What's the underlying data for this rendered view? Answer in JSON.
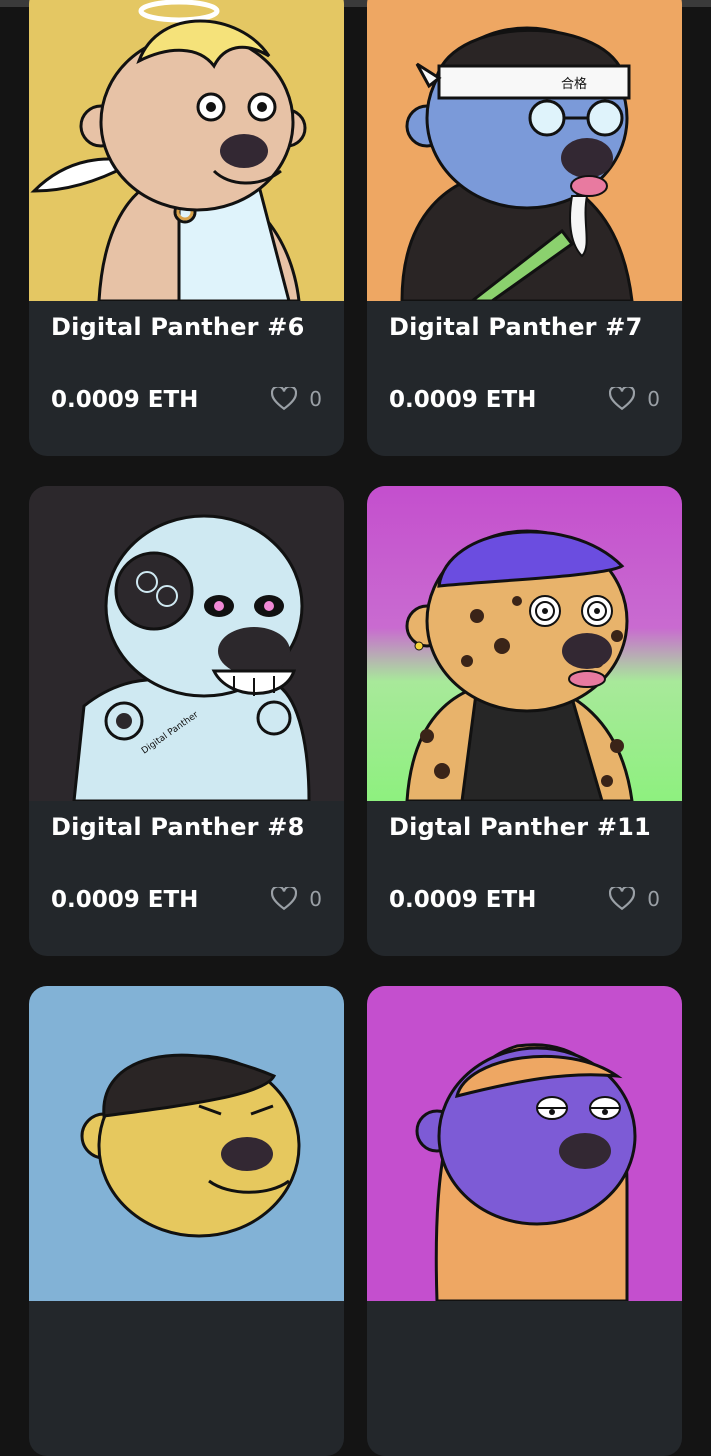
{
  "cards": [
    {
      "name": "Digital Panther #6",
      "price": "0.0009 ETH",
      "likes": "0",
      "art": "angel-bear-art",
      "bg": "#e4c763"
    },
    {
      "name": "Digital Panther #7",
      "price": "0.0009 ETH",
      "likes": "0",
      "art": "student-bear-art",
      "bg": "#eea763"
    },
    {
      "name": "Digital Panther #8",
      "price": "0.0009 ETH",
      "likes": "0",
      "art": "robot-panther-art",
      "bg": "#2c282c"
    },
    {
      "name": "Digtal Panther #11",
      "price": "0.0009 ETH",
      "likes": "0",
      "art": "leopard-panther-art",
      "bg": "#c44fce"
    },
    {
      "name": "",
      "price": "",
      "likes": "",
      "art": "yellow-bear-art",
      "bg": "#82b2d6"
    },
    {
      "name": "",
      "price": "",
      "likes": "",
      "art": "purple-bear-art",
      "bg": "#c44fce"
    }
  ],
  "art_text": {
    "headband_label": "合格",
    "robot_tag": "Digital Panther"
  },
  "icons": {
    "like": "heart-outline-icon"
  },
  "colors": {
    "card_bg": "#23272b",
    "page_bg": "#141414",
    "like_count": "#9aa0a6"
  }
}
